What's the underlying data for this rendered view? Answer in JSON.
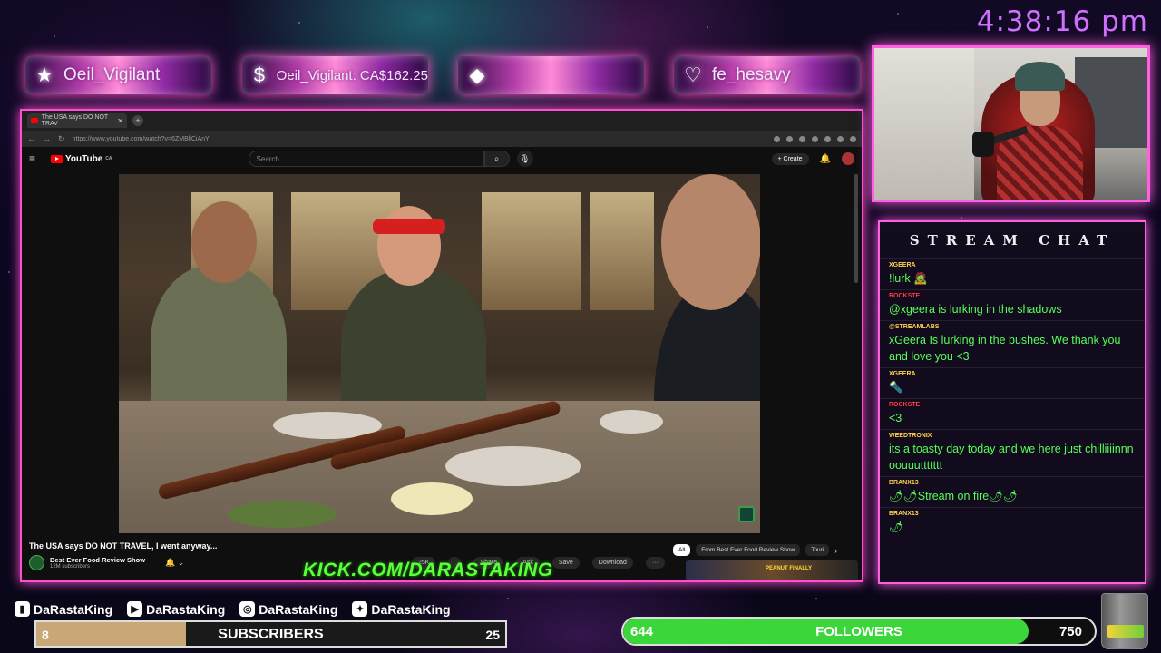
{
  "clock": "4:38:16 pm",
  "alerts": [
    {
      "icon": "star-icon",
      "glyph": "★",
      "text": "Oeil_Vigilant"
    },
    {
      "icon": "dollar-icon",
      "glyph": "$",
      "text": "Oeil_Vigilant: CA$162.25"
    },
    {
      "icon": "diamond-icon",
      "glyph": "◆",
      "text": ""
    },
    {
      "icon": "heart-icon",
      "glyph": "♡",
      "text": "fe_hesavy"
    }
  ],
  "browser": {
    "tab_title": "The USA says DO NOT TRAV",
    "url": "https://www.youtube.com/watch?v=6ZMBllCiAnY"
  },
  "youtube": {
    "logo": "YouTube",
    "logo_suffix": "CA",
    "search_placeholder": "Search",
    "create_label": "+ Create",
    "video_title": "The USA says DO NOT TRAVEL, I went anyway...",
    "channel_name": "Best Ever Food Review Show",
    "channel_subs": "12M subscribers",
    "actions": [
      "25K",
      "",
      "Share",
      "Ask",
      "Save",
      "Download",
      "···"
    ],
    "chips": [
      "All",
      "From Best Ever Food Review Show",
      "Touri"
    ],
    "rec_text": "PEANUT FINALLY"
  },
  "overlay_text": "KICK.COM/DARASTAKING",
  "chat": {
    "title": "STREAM CHAT",
    "messages": [
      {
        "user": "XGEERA",
        "user_color": "#ffd34a",
        "text": "!lurk 🧟"
      },
      {
        "user": "ROCKSTE",
        "user_color": "#ff3d3d",
        "text": "@xgeera is lurking in the shadows"
      },
      {
        "user": "@STREAMLABS",
        "user_color": "#ffd34a",
        "text": "xGeera Is lurking in the bushes. We thank you and love you <3"
      },
      {
        "user": "XGEERA",
        "user_color": "#ffd34a",
        "text": "🔦"
      },
      {
        "user": "ROCKSTE",
        "user_color": "#ff3d3d",
        "text": "<3"
      },
      {
        "user": "WEEDTRONIX",
        "user_color": "#ffd34a",
        "text": "its a toasty day today and we here just chilliiiinnn oouuuttttttt"
      },
      {
        "user": "BRANX13",
        "user_color": "#ffd34a",
        "text": "🌶🌶Stream on fire🌶🌶"
      },
      {
        "user": "BRANX13",
        "user_color": "#ffd34a",
        "text": "🌶"
      }
    ]
  },
  "socials": [
    {
      "icon": "twitch-icon",
      "glyph": "▮",
      "handle": "DaRastaKing"
    },
    {
      "icon": "youtube-icon",
      "glyph": "▶",
      "handle": "DaRastaKing"
    },
    {
      "icon": "instagram-icon",
      "glyph": "◎",
      "handle": "DaRastaKing"
    },
    {
      "icon": "twitter-icon",
      "glyph": "✦",
      "handle": "DaRastaKing"
    }
  ],
  "subscribers": {
    "current": "8",
    "label": "SUBSCRIBERS",
    "goal": "25",
    "progress": 0.32,
    "color": "#c9a877"
  },
  "followers": {
    "current": "644",
    "label": "FOLLOWERS",
    "goal": "750",
    "progress": 0.859,
    "color": "#3ad63a"
  }
}
